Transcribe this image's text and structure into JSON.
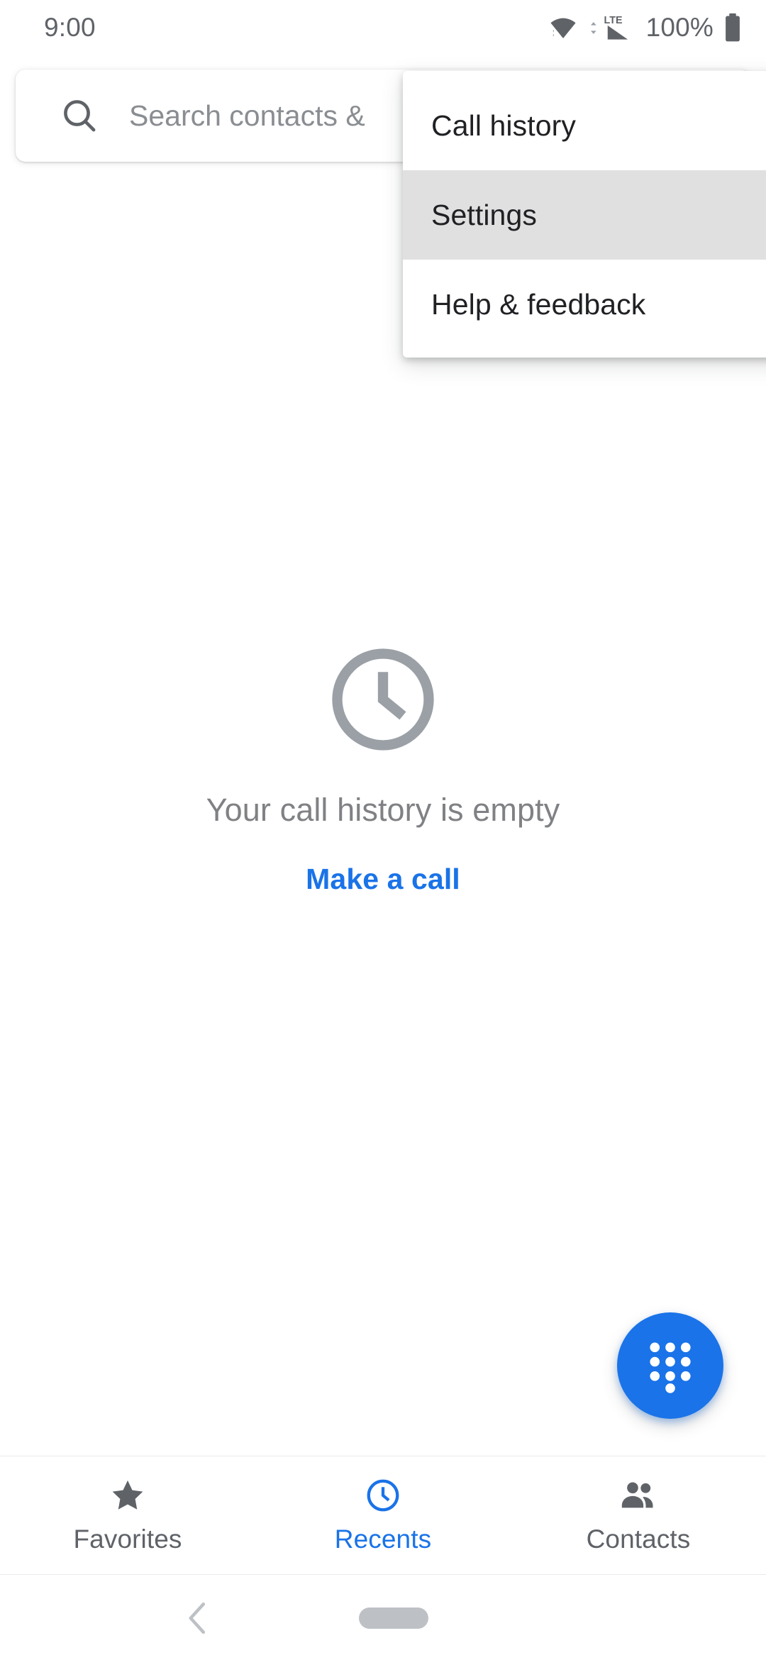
{
  "status_bar": {
    "clock": "9:00",
    "battery_percent": "100%",
    "network_label": "LTE",
    "icons": [
      "wifi-icon",
      "lte-signal-icon",
      "battery-icon"
    ]
  },
  "search": {
    "placeholder": "Search contacts & places",
    "visible_text": "Search contacts &",
    "icon": "search-icon"
  },
  "overflow_menu": {
    "items": [
      {
        "label": "Call history",
        "pressed": false
      },
      {
        "label": "Settings",
        "pressed": true
      },
      {
        "label": "Help & feedback",
        "pressed": false
      }
    ],
    "pressed_bg": "#e0e0e0"
  },
  "empty_state": {
    "icon": "clock-icon",
    "title": "Your call history is empty",
    "action_label": "Make a call",
    "title_color": "#7f8184",
    "action_color": "#1a73e8"
  },
  "fab": {
    "icon": "dialpad-icon",
    "color": "#1a73e8"
  },
  "bottom_nav": {
    "active_color": "#1a73e8",
    "inactive_color": "#5f6368",
    "tabs": [
      {
        "label": "Favorites",
        "icon": "star-icon",
        "active": false
      },
      {
        "label": "Recents",
        "icon": "clock-icon",
        "active": true
      },
      {
        "label": "Contacts",
        "icon": "people-icon",
        "active": false
      }
    ]
  },
  "system_nav": {
    "back": "back-chevron-icon",
    "home": "home-pill-icon"
  }
}
